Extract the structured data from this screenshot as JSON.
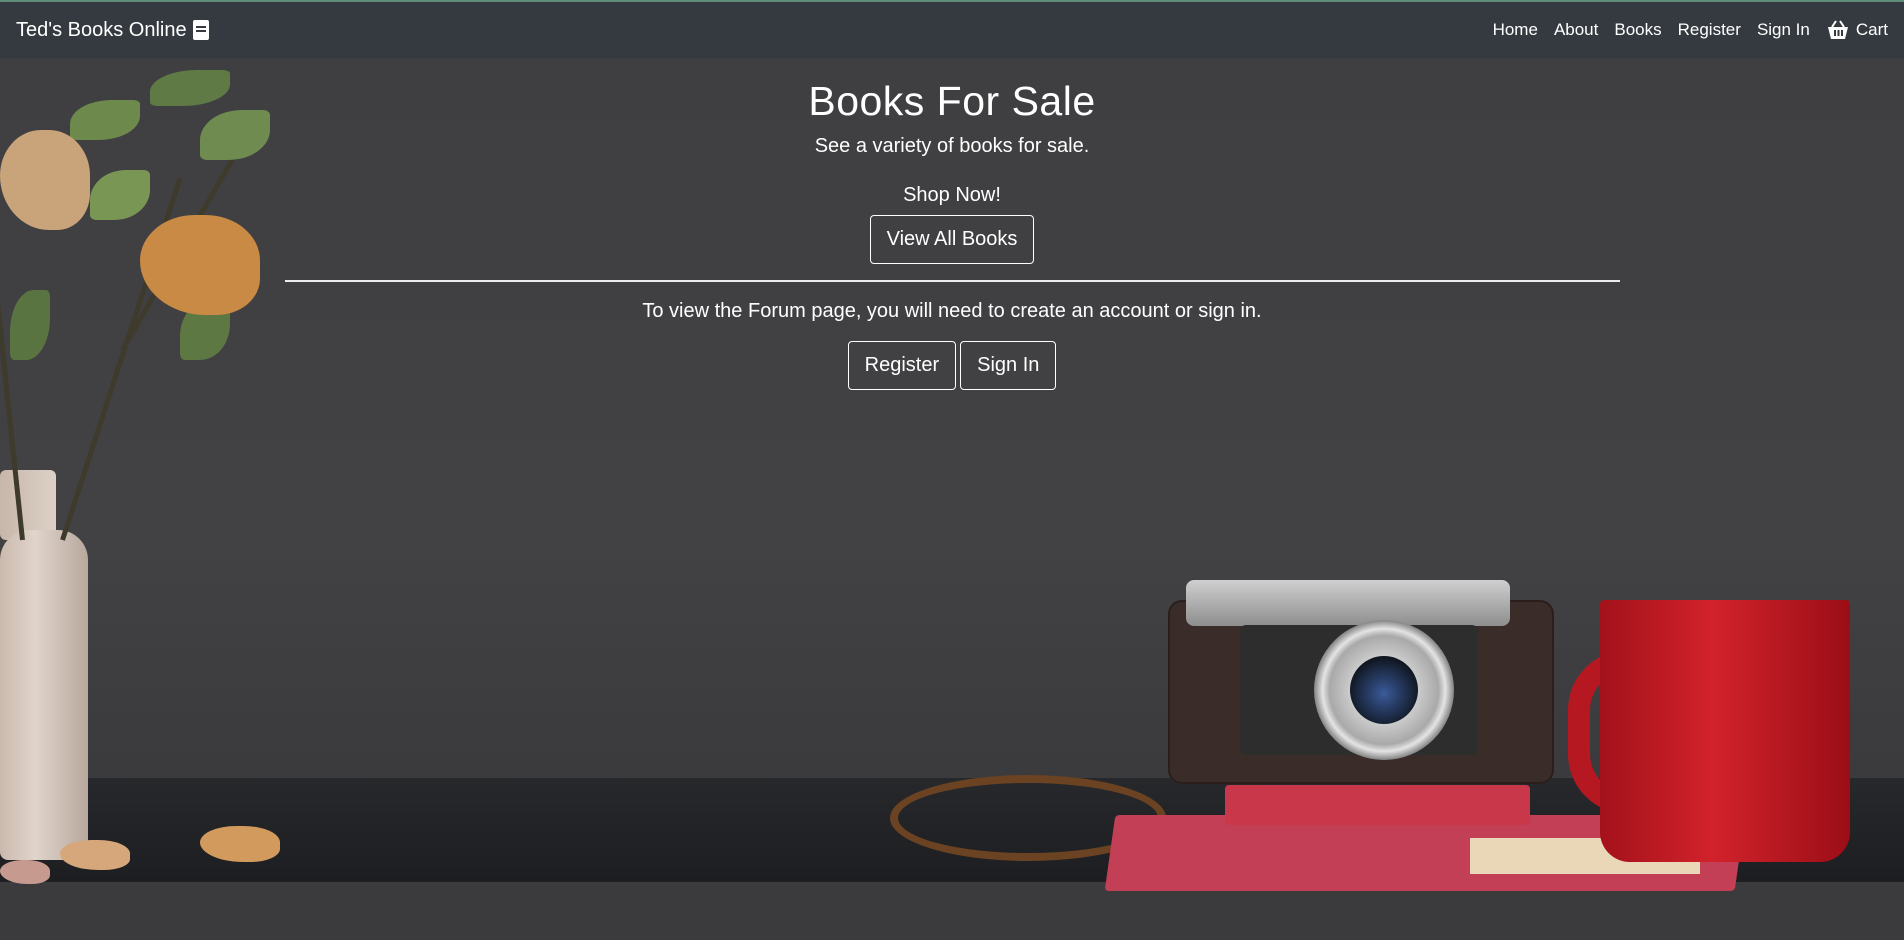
{
  "navbar": {
    "brand": "Ted's Books Online",
    "brand_icon": "book-icon",
    "links": [
      {
        "label": "Home"
      },
      {
        "label": "About"
      },
      {
        "label": "Books"
      },
      {
        "label": "Register"
      },
      {
        "label": "Sign In"
      }
    ],
    "cart": {
      "label": "Cart",
      "icon": "shopping-basket-icon"
    }
  },
  "hero": {
    "title": "Books For Sale",
    "subtitle": "See a variety of books for sale.",
    "shop_text": "Shop Now!",
    "view_all_button": "View All Books",
    "forum_text": "To view the Forum page, you will need to create an account or sign in.",
    "register_button": "Register",
    "signin_button": "Sign In"
  },
  "colors": {
    "navbar_bg": "#343a40",
    "background": "#3f3f41",
    "text": "#ffffff"
  }
}
